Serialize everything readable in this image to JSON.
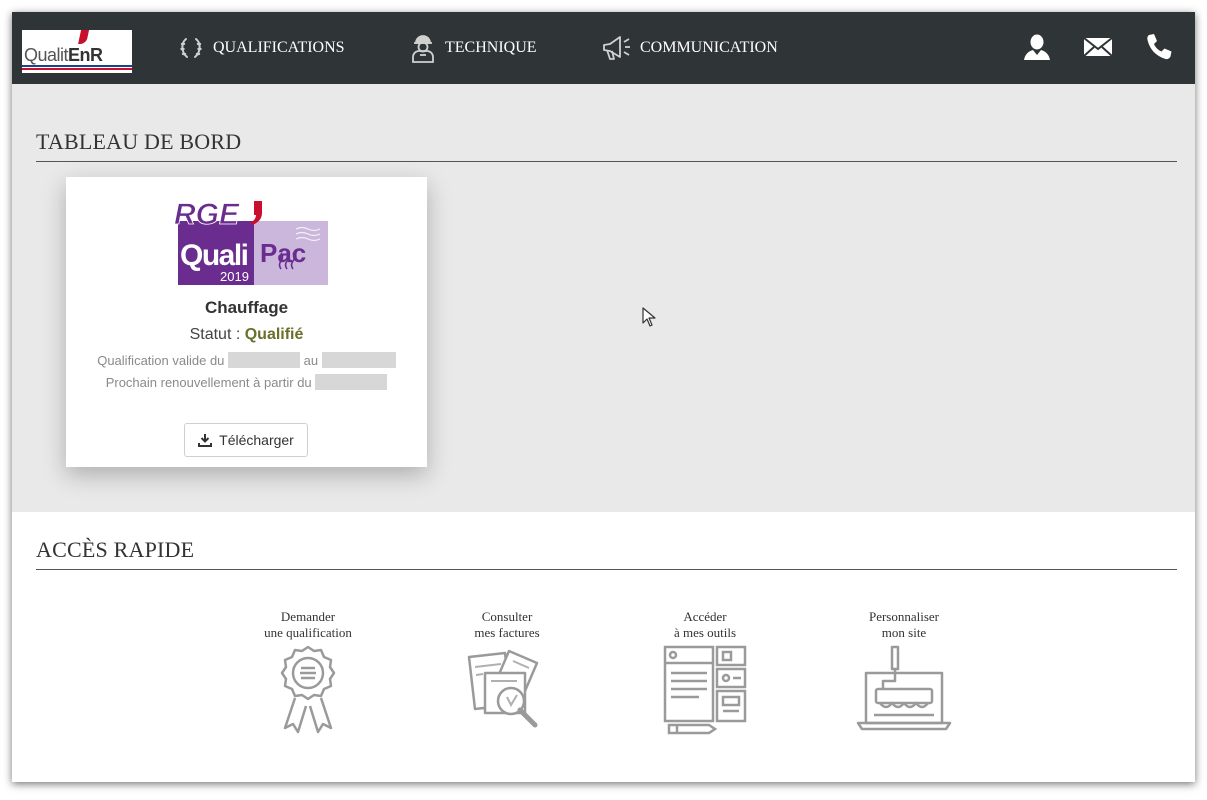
{
  "brand": {
    "logo_text": "Qualit",
    "logo_suffix": "EnR"
  },
  "nav": {
    "items": [
      {
        "label": "QUALIFICATIONS",
        "icon": "laurel-icon"
      },
      {
        "label": "TECHNIQUE",
        "icon": "worker-icon"
      },
      {
        "label": "COMMUNICATION",
        "icon": "megaphone-icon"
      }
    ],
    "right_icons": [
      "user-icon",
      "mail-icon",
      "phone-icon"
    ]
  },
  "dashboard": {
    "title": "TABLEAU DE BORD",
    "card": {
      "badge": {
        "top": "RGE",
        "left": "Quali",
        "right": "Pac",
        "year": "2019"
      },
      "title": "Chauffage",
      "status_label": "Statut : ",
      "status_value": "Qualifié",
      "validity_prefix": "Qualification valide du",
      "validity_mid": "au",
      "renewal_prefix": "Prochain renouvellement à partir du",
      "download_label": "Télécharger"
    }
  },
  "quick_access": {
    "title": "ACCÈS RAPIDE",
    "items": [
      {
        "line1": "Demander",
        "line2": "une qualification",
        "icon": "certificate-icon"
      },
      {
        "line1": "Consulter",
        "line2": "mes factures",
        "icon": "invoice-search-icon"
      },
      {
        "line1": "Accéder",
        "line2": "à mes outils",
        "icon": "tools-layout-icon"
      },
      {
        "line1": "Personnaliser",
        "line2": "mon site",
        "icon": "paint-roller-screen-icon"
      }
    ]
  },
  "colors": {
    "navbar": "#2f3436",
    "badge_purple": "#6a2c8e",
    "status_green": "#6b6f2c",
    "accent_red": "#c8102e"
  }
}
